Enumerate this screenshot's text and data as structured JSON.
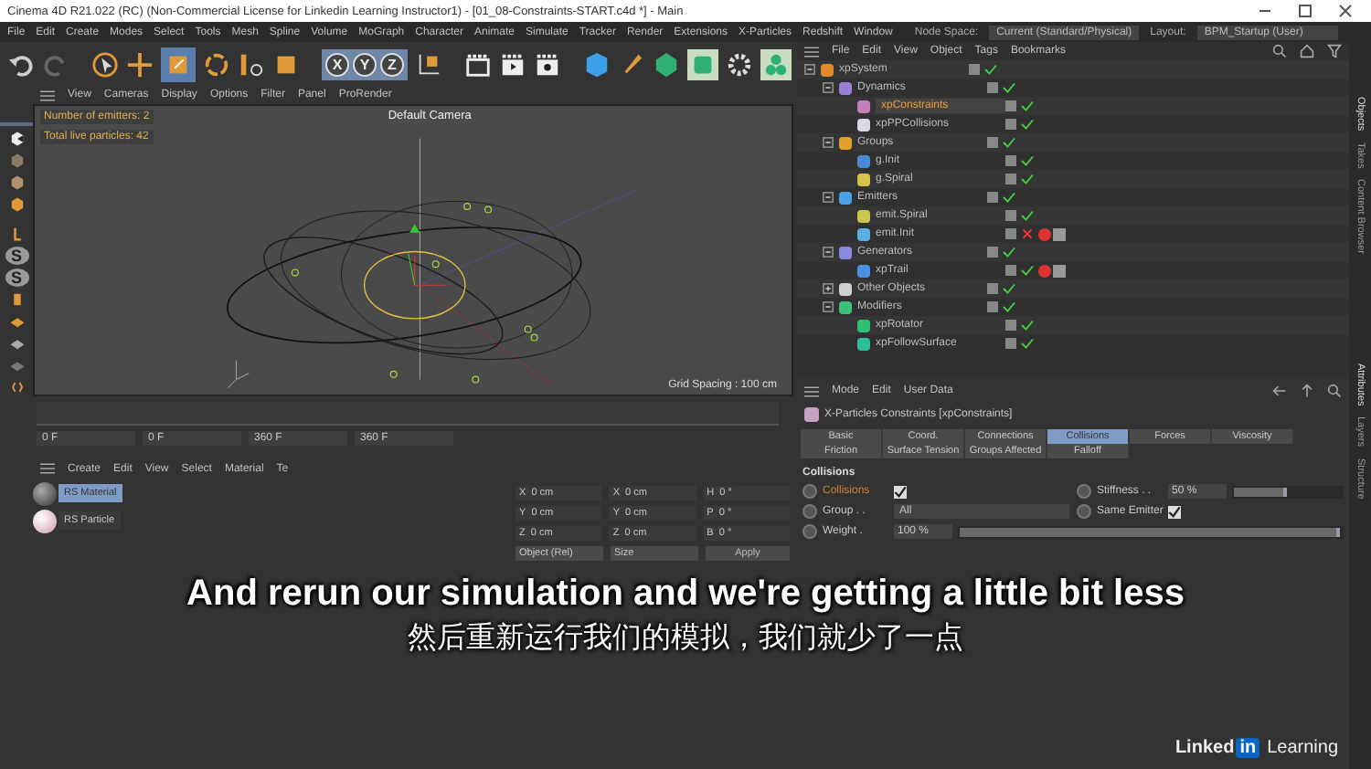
{
  "window": {
    "title": "Cinema 4D R21.022 (RC) (Non-Commercial License for Linkedin Learning Instructor1) - [01_08-Constraints-START.c4d *] - Main"
  },
  "menu": [
    "File",
    "Edit",
    "Create",
    "Modes",
    "Select",
    "Tools",
    "Mesh",
    "Spline",
    "Volume",
    "MoGraph",
    "Character",
    "Animate",
    "Simulate",
    "Tracker",
    "Render",
    "Extensions",
    "X-Particles",
    "Redshift",
    "Window"
  ],
  "node_space": {
    "label": "Node Space:",
    "value": "Current (Standard/Physical)"
  },
  "layout": {
    "label": "Layout:",
    "value": "BPM_Startup (User)"
  },
  "toolbar": {
    "axes": [
      "X",
      "Y",
      "Z"
    ]
  },
  "left_toolbar": {
    "snap_labels": [
      "S",
      "S"
    ]
  },
  "viewport": {
    "menu": [
      "View",
      "Cameras",
      "Display",
      "Options",
      "Filter",
      "Panel",
      "ProRender"
    ],
    "camera": "Default Camera",
    "hud": [
      "Number of emitters: 2",
      "Total live particles: 42"
    ],
    "grid_spacing": "Grid Spacing : 100 cm"
  },
  "timeline": {
    "fields": [
      "0 F",
      "0 F",
      "360 F",
      "360 F"
    ]
  },
  "materials": {
    "menu": [
      "Create",
      "Edit",
      "View",
      "Select",
      "Material",
      "Te"
    ],
    "items": [
      {
        "name": "RS Material",
        "selected": true
      },
      {
        "name": "RS Particle",
        "selected": false
      }
    ]
  },
  "coordinates": {
    "rows": [
      [
        {
          "axis": "X",
          "value": "0 cm"
        },
        {
          "axis": "X",
          "value": "0 cm"
        },
        {
          "axis": "H",
          "value": "0 °"
        }
      ],
      [
        {
          "axis": "Y",
          "value": "0 cm"
        },
        {
          "axis": "Y",
          "value": "0 cm"
        },
        {
          "axis": "P",
          "value": "0 °"
        }
      ],
      [
        {
          "axis": "Z",
          "value": "0 cm"
        },
        {
          "axis": "Z",
          "value": "0 cm"
        },
        {
          "axis": "B",
          "value": "0 °"
        }
      ]
    ],
    "dropdowns": [
      "Object (Rel)",
      "Size"
    ],
    "apply": "Apply"
  },
  "object_manager": {
    "menu": [
      "File",
      "Edit",
      "View",
      "Object",
      "Tags",
      "Bookmarks"
    ],
    "tree": [
      {
        "name": "xpSystem",
        "color": "#e08a2c",
        "selected": false,
        "enabled": true,
        "expanded": true,
        "children": [
          {
            "name": "Dynamics",
            "color": "#9b7fd6",
            "selected": false,
            "enabled": true,
            "expanded": true,
            "children": [
              {
                "name": "xpConstraints",
                "color": "#c27fb8",
                "selected": true,
                "enabled": true
              },
              {
                "name": "xpPPCollisions",
                "color": "#d9d9e6",
                "selected": false,
                "enabled": true
              }
            ]
          },
          {
            "name": "Groups",
            "color": "#e0a22c",
            "selected": false,
            "enabled": true,
            "expanded": true,
            "children": [
              {
                "name": "g.Init",
                "color": "#4a8ad6",
                "selected": false,
                "enabled": true
              },
              {
                "name": "g.Spiral",
                "color": "#d6c24a",
                "selected": false,
                "enabled": true
              }
            ]
          },
          {
            "name": "Emitters",
            "color": "#4aa0e0",
            "selected": false,
            "enabled": true,
            "expanded": true,
            "children": [
              {
                "name": "emit.Spiral",
                "color": "#c8c84a",
                "selected": false,
                "enabled": true
              },
              {
                "name": "emit.Init",
                "color": "#5ab0e0",
                "selected": false,
                "enabled": false,
                "material_tags": true
              }
            ]
          },
          {
            "name": "Generators",
            "color": "#8a8ae0",
            "selected": false,
            "enabled": true,
            "expanded": true,
            "children": [
              {
                "name": "xpTrail",
                "color": "#4a90e0",
                "selected": false,
                "enabled": true,
                "material_tags": true
              }
            ]
          },
          {
            "name": "Other Objects",
            "color": "#d0d0d0",
            "selected": false,
            "enabled": true,
            "expanded": false
          },
          {
            "name": "Modifiers",
            "color": "#3ec07a",
            "selected": false,
            "enabled": true,
            "expanded": true,
            "children": [
              {
                "name": "xpRotator",
                "color": "#2ec070",
                "selected": false,
                "enabled": true
              },
              {
                "name": "xpFollowSurface",
                "color": "#2ec09a",
                "selected": false,
                "enabled": true
              }
            ]
          }
        ]
      }
    ]
  },
  "attributes": {
    "menu": [
      "Mode",
      "Edit",
      "User Data"
    ],
    "title": "X-Particles Constraints [xpConstraints]",
    "tabs": [
      {
        "label": "Basic",
        "selected": false
      },
      {
        "label": "Coord.",
        "selected": false
      },
      {
        "label": "Connections",
        "selected": false
      },
      {
        "label": "Collisions",
        "selected": true
      },
      {
        "label": "Forces",
        "selected": false
      },
      {
        "label": "Viscosity",
        "selected": false
      },
      {
        "label": "Friction",
        "selected": false
      },
      {
        "label": "Surface Tension",
        "selected": false
      },
      {
        "label": "Groups Affected",
        "selected": false
      },
      {
        "label": "Falloff",
        "selected": false
      }
    ],
    "section": "Collisions",
    "fields": [
      {
        "kind": "checkbox",
        "label": "Collisions",
        "checked": true
      },
      {
        "kind": "slider",
        "label": "Stiffness . .",
        "value": "50 %",
        "level": 0.5
      },
      {
        "kind": "dropdown",
        "label": "Group . .",
        "value": "All"
      },
      {
        "kind": "checkbox",
        "label": "Same Emitter",
        "checked": true
      },
      {
        "kind": "slider",
        "label": "Weight .",
        "value": "100 %",
        "level": 1
      }
    ]
  },
  "side_tabs": [
    {
      "label": "Objects",
      "selected": true
    },
    {
      "label": "Takes",
      "selected": false
    },
    {
      "label": "Content Browser",
      "selected": false
    },
    {
      "label": "Attributes",
      "selected": true
    },
    {
      "label": "Layers",
      "selected": false
    },
    {
      "label": "Structure",
      "selected": false
    }
  ],
  "subtitles": [
    "And rerun our simulation and we're getting a little bit less",
    "然后重新运行我们的模拟，我们就少了一点"
  ],
  "brand": {
    "name": "Linked",
    "badge": "in",
    "suffix": "Learning"
  }
}
